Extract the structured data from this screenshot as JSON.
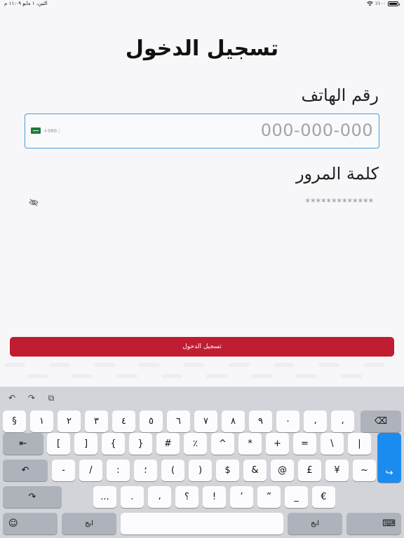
{
  "status": {
    "time": "الثين، ١ مايو  ١١:٠٩ م",
    "battery_pct": "٪١٠٠"
  },
  "title": "تسجيل الدخول",
  "phone": {
    "label": "رقم الهاتف",
    "placeholder": "000-000-000",
    "country_code": "+966"
  },
  "password": {
    "label": "كلمة المرور",
    "value": "*************"
  },
  "login_button": "تسجيل الدخول",
  "keyboard": {
    "row1": [
      "§",
      "١",
      "٢",
      "٣",
      "٤",
      "٥",
      "٦",
      "٧",
      "٨",
      "٩",
      "٠",
      "،",
      "،"
    ],
    "row2": [
      "[",
      "]",
      "{",
      "}",
      "#",
      "٪",
      "^",
      "*",
      "+",
      "=",
      "\\",
      "|"
    ],
    "row3": [
      "-",
      "/",
      ":",
      "؛",
      "(",
      ")",
      "$",
      "&",
      "@",
      "£",
      "¥",
      "~"
    ],
    "row4": [
      "...",
      ".",
      "،",
      "؟",
      "!",
      "’",
      "”",
      "_",
      "€"
    ],
    "lang_left": "ابج",
    "lang_right": "ابج"
  }
}
